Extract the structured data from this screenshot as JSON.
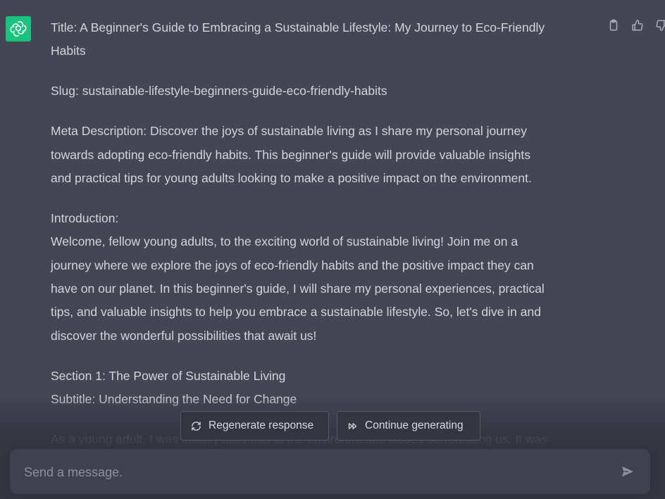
{
  "message": {
    "title_line1": "Title: A Beginner's Guide to Embracing a Sustainable Lifestyle: My Journey to Eco-Friendly",
    "title_line2": "Habits",
    "slug": "Slug: sustainable-lifestyle-beginners-guide-eco-friendly-habits",
    "meta_line1": "Meta Description: Discover the joys of sustainable living as I share my personal journey",
    "meta_line2": "towards adopting eco-friendly habits. This beginner's guide will provide valuable insights",
    "meta_line3": "and practical tips for young adults looking to make a positive impact on the environment.",
    "intro_heading": "Introduction:",
    "intro_line1": "Welcome, fellow young adults, to the exciting world of sustainable living! Join me on a",
    "intro_line2": "journey where we explore the joys of eco-friendly habits and the positive impact they can",
    "intro_line3": "have on our planet. In this beginner's guide, I will share my personal experiences, practical",
    "intro_line4": "tips, and valuable insights to help you embrace a sustainable lifestyle. So, let's dive in and",
    "intro_line5": "discover the wonderful possibilities that await us!",
    "section1": "Section 1: The Power of Sustainable Living",
    "subtitle1": "Subtitle: Understanding the Need for Change",
    "cutoff_line": "As a young adult, I was initially oblivious to the environmental issues surrounding us. It was"
  },
  "actions": {
    "icons": [
      "clipboard-icon",
      "thumbs-up-icon",
      "thumbs-down-icon"
    ]
  },
  "buttons": {
    "regenerate": "Regenerate response",
    "continue": "Continue generating"
  },
  "composer": {
    "placeholder": "Send a message."
  },
  "colors": {
    "background": "#444654",
    "text": "#d1d5db",
    "avatar": "#19c37d",
    "composer": "#40414f"
  }
}
